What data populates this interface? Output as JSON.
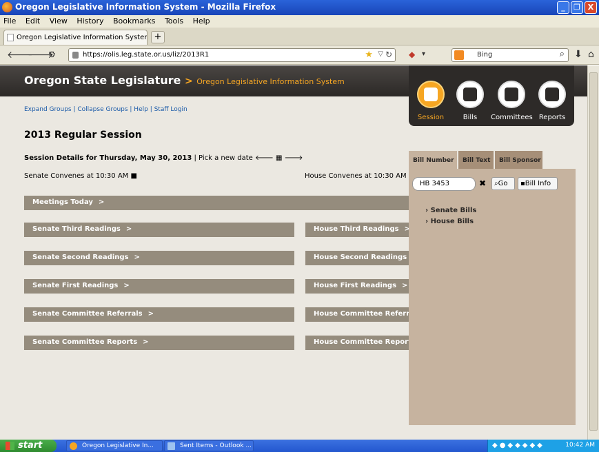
{
  "window": {
    "title": "Oregon Legislative Information System - Mozilla Firefox",
    "minimize": "_",
    "maximize": "❐",
    "close": "X"
  },
  "menu": [
    "File",
    "Edit",
    "View",
    "History",
    "Bookmarks",
    "Tools",
    "Help"
  ],
  "tab": {
    "label": "Oregon Legislative Information System",
    "new_tab": "+"
  },
  "nav": {
    "url": "https://olis.leg.state.or.us/liz/2013R1",
    "search_engine": "Bing"
  },
  "site": {
    "name": "Oregon State Legislature",
    "separator": ">",
    "subtitle": "Oregon Legislative Information System"
  },
  "top_nav": {
    "items": [
      {
        "label": "Session",
        "icon": "calendar-icon"
      },
      {
        "label": "Bills",
        "icon": "document-icon"
      },
      {
        "label": "Committees",
        "icon": "people-icon"
      },
      {
        "label": "Reports",
        "icon": "report-icon"
      }
    ],
    "active_color": "#f6a623"
  },
  "links": "Expand Groups | Collapse Groups | Help | Staff Login",
  "session": {
    "title": "2013 Regular Session",
    "details_label": "Session Details for Thursday, May 30, 2013",
    "pick_date": "| Pick a new date",
    "senate_convenes": "Senate Convenes at 10:30 AM",
    "house_convenes": "House Convenes at 10:30 AM"
  },
  "sections": {
    "meetings": "Meetings Today",
    "senate": [
      "Senate Third Readings",
      "Senate Second Readings",
      "Senate First Readings",
      "Senate Committee Referrals",
      "Senate Committee Reports"
    ],
    "house": [
      "House Third Readings",
      "House Second Readings",
      "House First Readings",
      "House Committee Referrals",
      "House Committee Reports"
    ],
    "chevron": ">"
  },
  "panel": {
    "tabs": [
      "Bill Number",
      "Bill Text",
      "Bill Sponsor"
    ],
    "bill_input_value": "HB 3453",
    "clear": "✖",
    "go": "Go",
    "bill_info": "Bill Info",
    "links": [
      "Senate Bills",
      "House Bills"
    ]
  },
  "taskbar": {
    "start": "start",
    "items": [
      "Oregon Legislative In...",
      "Sent Items - Outlook ..."
    ],
    "clock": "10:42 AM"
  }
}
